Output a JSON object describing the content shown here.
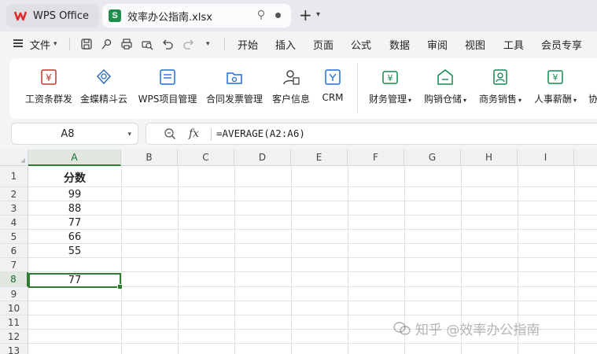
{
  "titlebar": {
    "home_tab": "WPS Office",
    "file_tab": "效率办公指南.xlsx",
    "file_badge": "S"
  },
  "menubar": {
    "file_menu": "文件",
    "items": [
      "开始",
      "插入",
      "页面",
      "公式",
      "数据",
      "审阅",
      "视图",
      "工具",
      "会员专享"
    ]
  },
  "ribbon": {
    "items": [
      {
        "label": "工资条群发",
        "icon": "payslip-icon"
      },
      {
        "label": "金蝶精斗云",
        "icon": "cloud-icon"
      },
      {
        "label": "WPS项目管理",
        "icon": "project-icon"
      },
      {
        "label": "合同发票管理",
        "icon": "contract-icon"
      },
      {
        "label": "客户信息",
        "icon": "customer-icon"
      },
      {
        "label": "CRM",
        "icon": "crm-icon"
      },
      {
        "label": "财务管理",
        "icon": "finance-icon",
        "dropdown": true
      },
      {
        "label": "购销仓储",
        "icon": "warehouse-icon",
        "dropdown": true
      },
      {
        "label": "商务销售",
        "icon": "sales-icon",
        "dropdown": true
      },
      {
        "label": "人事薪酬",
        "icon": "hr-icon",
        "dropdown": true
      },
      {
        "label": "协",
        "icon": "",
        "dropdown": false
      }
    ]
  },
  "formula_bar": {
    "name_box": "A8",
    "fx_label": "fx",
    "formula": "=AVERAGE(A2:A6)"
  },
  "sheet": {
    "columns": [
      "A",
      "B",
      "C",
      "D",
      "E",
      "F",
      "G",
      "H",
      "I"
    ],
    "rows": [
      "1",
      "2",
      "3",
      "4",
      "5",
      "6",
      "7",
      "8",
      "9",
      "10",
      "11",
      "12",
      "13"
    ],
    "cells_a": [
      "分数",
      "99",
      "88",
      "77",
      "66",
      "55",
      "",
      "77",
      "",
      "",
      "",
      "",
      ""
    ],
    "active_cell": "A8"
  },
  "watermark": "知乎 @效率办公指南",
  "colors": {
    "accent_green": "#2e7d32",
    "wps_red": "#e02b2b",
    "sheet_badge": "#1e8f4e"
  }
}
